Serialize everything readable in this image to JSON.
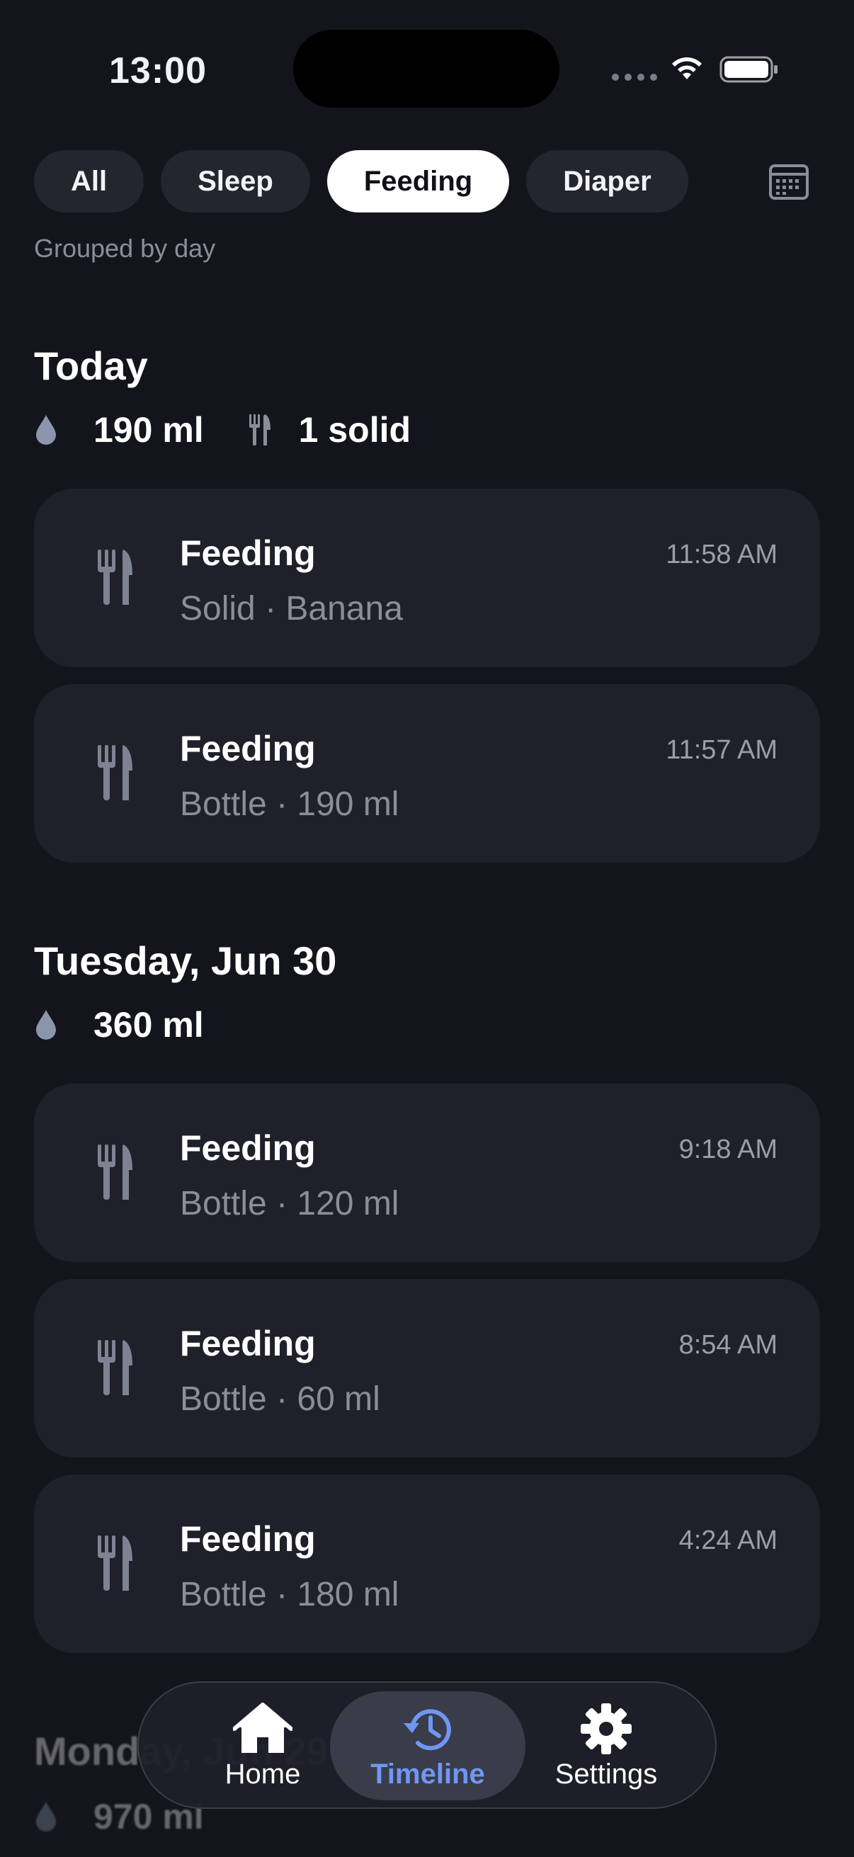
{
  "status_bar": {
    "time": "13:00"
  },
  "filters": [
    {
      "label": "All",
      "selected": false
    },
    {
      "label": "Sleep",
      "selected": false
    },
    {
      "label": "Feeding",
      "selected": true
    },
    {
      "label": "Diaper",
      "selected": false
    }
  ],
  "grouping_caption": "Grouped by day",
  "sections": [
    {
      "title": "Today",
      "summary": {
        "volume": "190 ml",
        "solids": "1 solid"
      },
      "entries": [
        {
          "title": "Feeding",
          "detail": "Solid · Banana",
          "time": "11:58 AM",
          "icon": "utensils-icon"
        },
        {
          "title": "Feeding",
          "detail": "Bottle · 190 ml",
          "time": "11:57 AM",
          "icon": "utensils-icon"
        }
      ]
    },
    {
      "title": "Tuesday, Jun 30",
      "summary": {
        "volume": "360 ml"
      },
      "entries": [
        {
          "title": "Feeding",
          "detail": "Bottle · 120 ml",
          "time": "9:18 AM",
          "icon": "utensils-icon"
        },
        {
          "title": "Feeding",
          "detail": "Bottle · 60 ml",
          "time": "8:54 AM",
          "icon": "utensils-icon"
        },
        {
          "title": "Feeding",
          "detail": "Bottle · 180 ml",
          "time": "4:24 AM",
          "icon": "utensils-icon"
        }
      ]
    },
    {
      "title": "Monday, Jun 29",
      "summary": {
        "volume": "970 ml"
      }
    }
  ],
  "tab_bar": {
    "tabs": [
      {
        "label": "Home",
        "icon": "house-icon",
        "selected": false
      },
      {
        "label": "Timeline",
        "icon": "history-icon",
        "selected": true
      },
      {
        "label": "Settings",
        "icon": "gear-icon",
        "selected": false
      }
    ]
  },
  "colors": {
    "background": "#14151c",
    "card": "#1f2029",
    "accent": "#6f97f2",
    "secondary_text": "#8b8e99"
  }
}
